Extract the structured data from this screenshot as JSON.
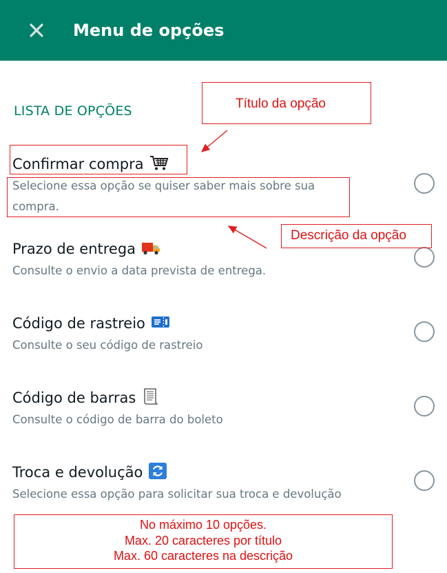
{
  "header": {
    "title": "Menu de opções",
    "close_icon": "close-icon",
    "background": "#008069"
  },
  "section_title": "LISTA DE OPÇÕES",
  "options": [
    {
      "title": "Confirmar compra",
      "emoji": "shopping-cart-icon",
      "description_lines": [
        "Selecione essa opção se quiser saber mais sobre sua",
        "compra."
      ],
      "selected": false
    },
    {
      "title": "Prazo de entrega",
      "emoji": "delivery-truck-icon",
      "description_lines": [
        "Consulte o envio a data prevista de entrega."
      ],
      "selected": false
    },
    {
      "title": "Código de rastreio",
      "emoji": "ticket-icon",
      "description_lines": [
        "Consulte o seu código de rastreio"
      ],
      "selected": false
    },
    {
      "title": "Código de barras",
      "emoji": "receipt-icon",
      "description_lines": [
        "Consulte o código de barra do boleto"
      ],
      "selected": false
    },
    {
      "title": "Troca e devolução",
      "emoji": "arrows-refresh-icon",
      "description_lines": [
        "Selecione essa opção para solicitar sua troca e devolução"
      ],
      "selected": false
    }
  ],
  "annotations": {
    "title_label": "Título da opção",
    "description_label": "Descrição da opção",
    "limits": [
      "No máximo 10 opções.",
      "Max. 20 caracteres por título",
      "Max. 60 caracteres na descrição"
    ],
    "color": "#e01010"
  }
}
